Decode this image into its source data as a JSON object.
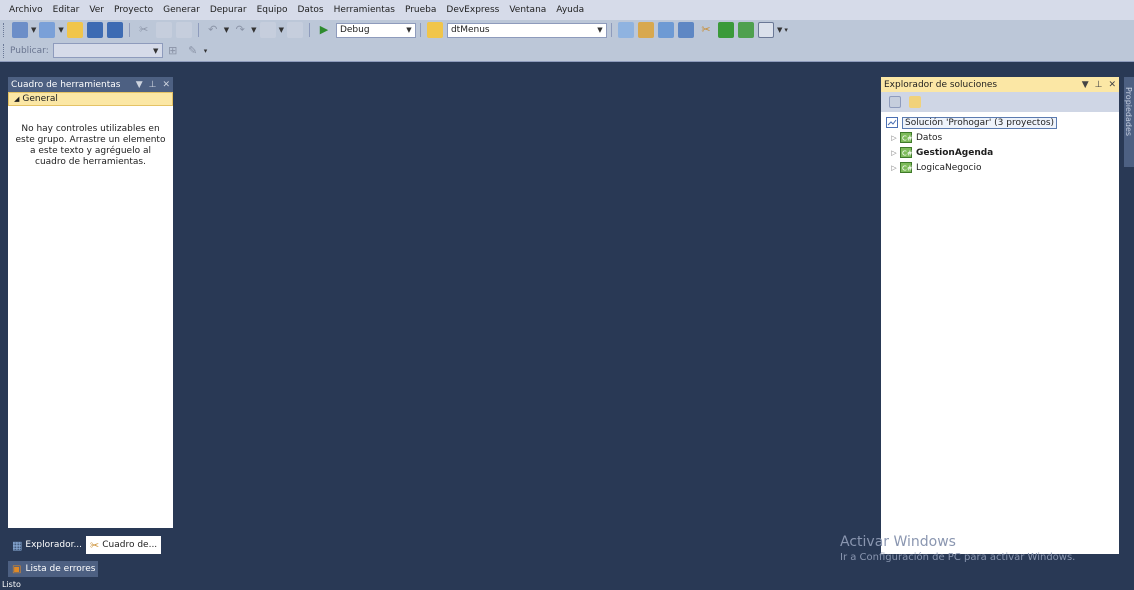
{
  "menu": [
    "Archivo",
    "Editar",
    "Ver",
    "Proyecto",
    "Generar",
    "Depurar",
    "Equipo",
    "Datos",
    "Herramientas",
    "Prueba",
    "DevExpress",
    "Ventana",
    "Ayuda"
  ],
  "toolbar": {
    "configuration": "Debug",
    "target": "dtMenus"
  },
  "publish": {
    "label": "Publicar:",
    "value": ""
  },
  "toolbox": {
    "title": "Cuadro de herramientas",
    "group": "General",
    "empty_message": "No hay controles utilizables en este grupo. Arrastre un elemento a este texto y agréguelo al cuadro de herramientas."
  },
  "bottom_tabs": {
    "explorer": "Explorador...",
    "toolbox": "Cuadro de...",
    "errors": "Lista de errores"
  },
  "solution_explorer": {
    "title": "Explorador de soluciones",
    "solution": "Solución 'Prohogar'  (3 proyectos)",
    "projects": [
      {
        "name": "Datos",
        "bold": false
      },
      {
        "name": "GestionAgenda",
        "bold": true
      },
      {
        "name": "LogicaNegocio",
        "bold": false
      }
    ]
  },
  "properties_tab": "Propiedades",
  "watermark": {
    "title": "Activar Windows",
    "subtitle": "Ir a Configuración de PC para activar Windows."
  },
  "status": "Listo",
  "colors": {
    "background": "#293955",
    "menubar": "#d6dbe9",
    "toolbar": "#bcc7d8",
    "active_header": "#fbe7a5",
    "panel_header": "#4d6082"
  }
}
